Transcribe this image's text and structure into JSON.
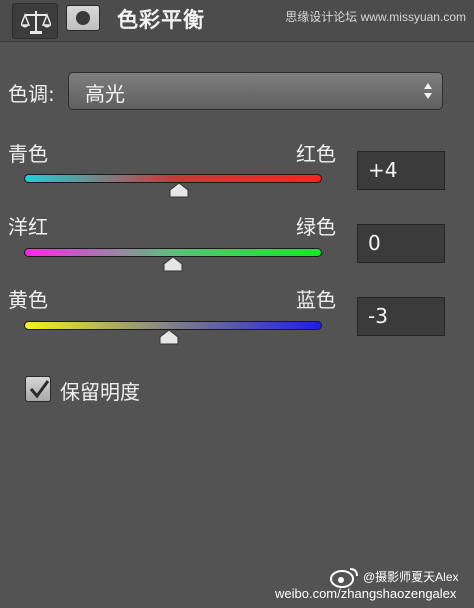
{
  "header": {
    "title": "色彩平衡",
    "adjustment_icon": "balance-scale-icon",
    "mask_icon": "layer-mask-icon",
    "watermark": "思缘设计论坛 www.missyuan.com"
  },
  "tone": {
    "label": "色调:",
    "selected": "高光"
  },
  "sliders": [
    {
      "left_label": "青色",
      "right_label": "红色",
      "value": "+4",
      "numeric": 4,
      "gradient": [
        "#1fd0d8",
        "#c93a3a",
        "#ff2222"
      ]
    },
    {
      "left_label": "洋红",
      "right_label": "绿色",
      "value": "0",
      "numeric": 0,
      "gradient": [
        "#ff25e8",
        "#5bc07a",
        "#18e626"
      ]
    },
    {
      "left_label": "黄色",
      "right_label": "蓝色",
      "value": "-3",
      "numeric": -3,
      "gradient": [
        "#f4f21c",
        "#7f7f8a",
        "#1e1ee8"
      ]
    }
  ],
  "slider_range": [
    -100,
    100
  ],
  "preserve": {
    "label": "保留明度",
    "checked": true
  },
  "credit": {
    "name": "@摄影师夏天Alex",
    "url": "weibo.com/zhangshaozengalex",
    "icon": "weibo-icon"
  }
}
